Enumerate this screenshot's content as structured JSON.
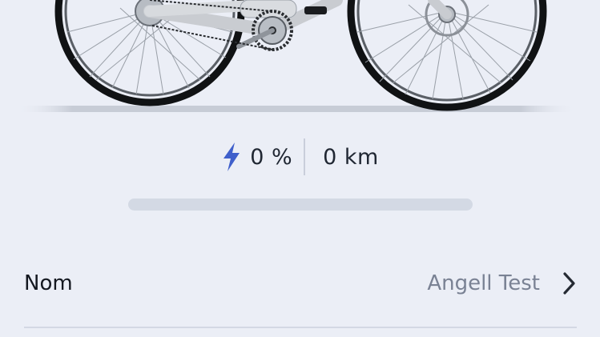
{
  "stats": {
    "battery_text": "0 %",
    "battery_level": 0,
    "distance_text": "0 km"
  },
  "settings": {
    "name_label": "Nom",
    "name_value": "Angell Test"
  },
  "icons": {
    "battery": "lightning-bolt-icon",
    "chevron": "chevron-right-icon"
  },
  "colors": {
    "accent": "#3f5fcb",
    "background": "#ebeef6"
  }
}
